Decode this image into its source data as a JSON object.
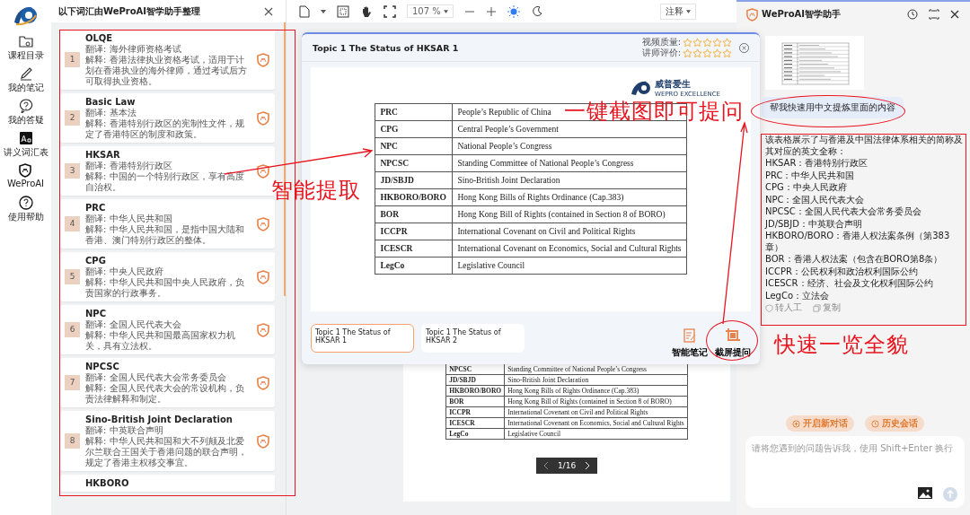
{
  "nav": {
    "items": [
      {
        "label": "课程目录"
      },
      {
        "label": "我的笔记"
      },
      {
        "label": "我的答疑"
      },
      {
        "label": "讲义词汇表"
      },
      {
        "label": "WeProAI"
      },
      {
        "label": "使用帮助"
      }
    ]
  },
  "vocab": {
    "title": "以下词汇由WeProAI智学助手整理",
    "items": [
      {
        "num": "1",
        "term": "OLQE",
        "translation": "翻译: 海外律师资格考试",
        "explanation": "解释: 香港法律执业资格考试，适用于计划在香港执业的海外律师，通过考试后方可取得执业资格。"
      },
      {
        "num": "2",
        "term": "Basic Law",
        "translation": "翻译: 基本法",
        "explanation": "解释: 香港特别行政区的宪制性文件，规定了香港特区的制度和政策。"
      },
      {
        "num": "3",
        "term": "HKSAR",
        "translation": "翻译: 香港特别行政区",
        "explanation": "解释: 中国的一个特别行政区，享有高度自治权。"
      },
      {
        "num": "4",
        "term": "PRC",
        "translation": "翻译: 中华人民共和国",
        "explanation": "解释: 中华人民共和国，是指中国大陆和香港、澳门特别行政区的整体。"
      },
      {
        "num": "5",
        "term": "CPG",
        "translation": "翻译: 中央人民政府",
        "explanation": "解释: 中华人民共和国中央人民政府，负责国家的行政事务。"
      },
      {
        "num": "6",
        "term": "NPC",
        "translation": "翻译: 全国人民代表大会",
        "explanation": "解释: 中华人民共和国最高国家权力机关，具有立法权。"
      },
      {
        "num": "7",
        "term": "NPCSC",
        "translation": "翻译: 全国人民代表大会常务委员会",
        "explanation": "解释: 全国人民代表大会的常设机构，负责法律解释和制定。"
      },
      {
        "num": "8",
        "term": "Sino-British Joint Declaration",
        "translation": "翻译: 中英联合声明",
        "explanation": "解释: 中华人民共和国和大不列颠及北爱尔兰联合王国关于香港问题的联合声明，规定了香港主权移交事宜。"
      },
      {
        "term": "HKBORO"
      }
    ]
  },
  "toolbar": {
    "zoom": "107 %",
    "annotate": "注释"
  },
  "dialog": {
    "title": "Topic 1 The Status of HKSAR 1",
    "ratings": [
      {
        "label": "视频质量:",
        "stars": 0
      },
      {
        "label": "讲师评价:",
        "stars": 0
      }
    ],
    "brand": "威普爱生",
    "brand_tagline": "WEPRO EXCELLENCE",
    "table": [
      [
        "PRC",
        "People’s Republic of China"
      ],
      [
        "CPG",
        "Central People’s Government"
      ],
      [
        "NPC",
        "National People’s Congress"
      ],
      [
        "NPCSC",
        "Standing Committee of National People’s Congress"
      ],
      [
        "JD/SBJD",
        "Sino-British Joint Declaration"
      ],
      [
        "HKBORO/BORO",
        "Hong Kong Bills of Rights Ordinance (Cap.383)"
      ],
      [
        "BOR",
        "Hong Kong Bill of Rights (contained in Section 8 of BORO)"
      ],
      [
        "ICCPR",
        "International Covenant on Civil and Political Rights"
      ],
      [
        "ICESCR",
        "International Covenant on Economics, Social and Cultural Rights"
      ],
      [
        "LegCo",
        "Legislative Council"
      ]
    ],
    "tabs": [
      {
        "label": "Topic 1 The Status of HKSAR 1",
        "selected": true
      },
      {
        "label": "Topic 1 The Status of HKSAR 2",
        "selected": false
      }
    ],
    "actions": [
      {
        "label": "智能笔记"
      },
      {
        "label": "截屏提问"
      }
    ]
  },
  "background_doc": {
    "table": [
      [
        "NPCSC",
        "Standing Committee of National People’s Congress"
      ],
      [
        "JD/SBJD",
        "Sino-British Joint Declaration"
      ],
      [
        "HKBORO/BORO",
        "Hong Kong Bills of Rights Ordinance (Cap.383)"
      ],
      [
        "BOR",
        "Hong Kong Bill of Rights (contained in Section 8 of BORO)"
      ],
      [
        "ICCPR",
        "International Covenant on Civil and Political Rights"
      ],
      [
        "ICESCR",
        "International Covenant on Economics, Social and Cultural Rights"
      ],
      [
        "LegCo",
        "Legislative Council"
      ]
    ],
    "page": "1/16"
  },
  "assistant": {
    "title": "WeProAI智学助手",
    "question": "帮我快速用中文提炼里面的内容",
    "answer": {
      "intro": "该表格展示了与香港及中国法律体系相关的简称及其对应的英文全称：",
      "lines": [
        "HKSAR：香港特别行政区",
        "PRC：中华人民共和国",
        "CPG：中央人民政府",
        "NPC：全国人民代表大会",
        "NPCSC：全国人民代表大会常务委员会",
        "JD/SBJD：中英联合声明",
        "HKBORO/BORO：香港人权法案条例（第383章）",
        "BOR：香港人权法案（包含在BORO第8条）",
        "ICCPR：公民权利和政治权利国际公约",
        "ICESCR：经济、社会及文化权利国际公约",
        "LegCo：立法会"
      ],
      "actions": [
        "转人工",
        "复制"
      ]
    },
    "buttons": [
      "开启新对话",
      "历史会话"
    ],
    "input": {
      "placeholder": "请将您遇到的问题告诉我，使用 Shift+Enter 换行"
    }
  },
  "annotations": [
    {
      "text": "智能提取"
    },
    {
      "text": "一键截图即可提问"
    },
    {
      "text": "快速一览全貌"
    }
  ]
}
